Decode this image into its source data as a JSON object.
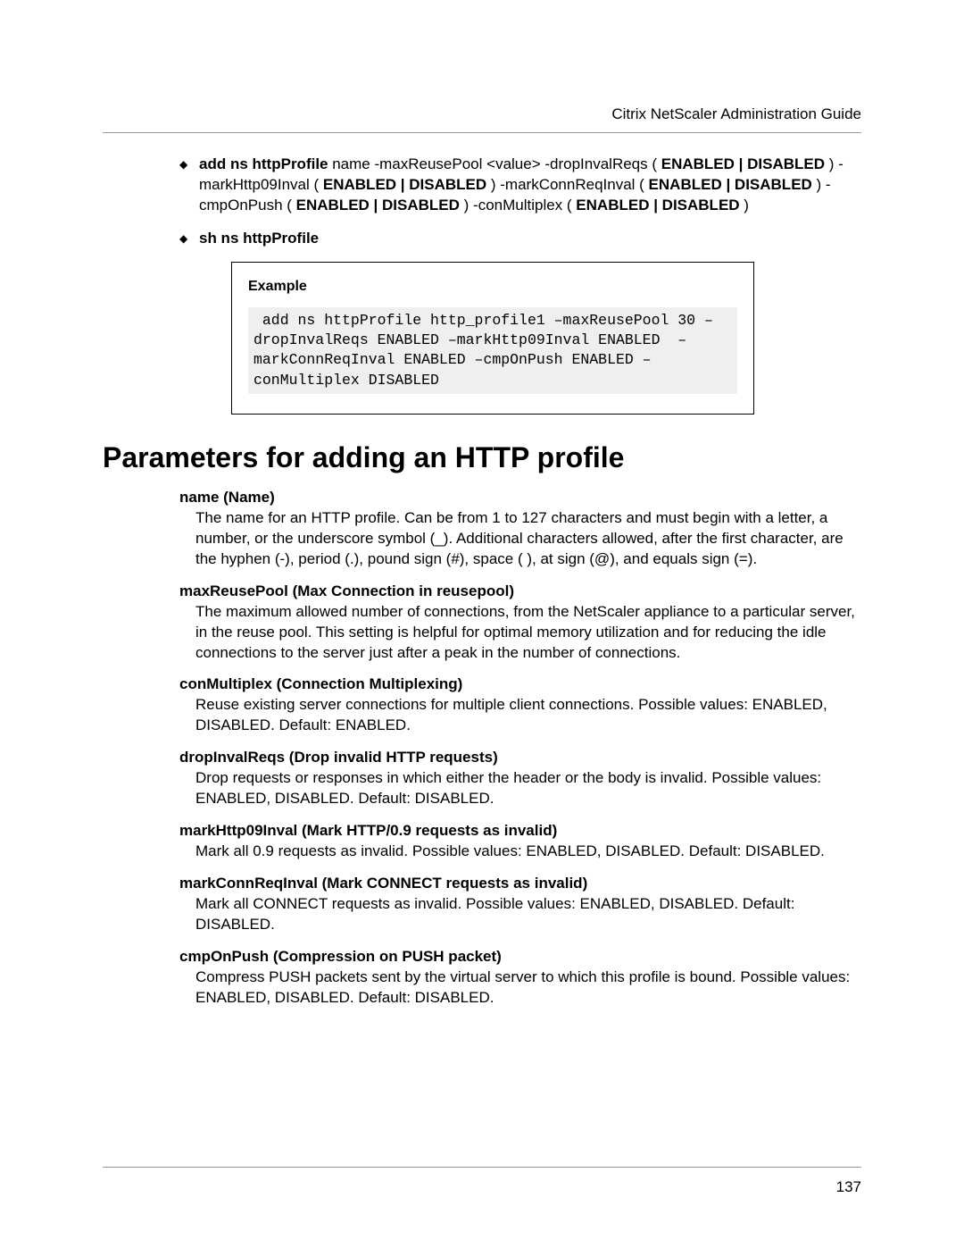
{
  "headerTitle": "Citrix NetScaler Administration Guide",
  "pageNumber": "137",
  "bullet1_parts": [
    {
      "t": "add ns httpProfile",
      "b": true
    },
    {
      "t": " name -maxReusePool <value> -dropInvalReqs ( ",
      "b": false
    },
    {
      "t": "ENABLED | DISABLED",
      "b": true
    },
    {
      "t": " ) -markHttp09Inval ( ",
      "b": false
    },
    {
      "t": "ENABLED | DISABLED",
      "b": true
    },
    {
      "t": " ) -markConnReqInval ( ",
      "b": false
    },
    {
      "t": "ENABLED | DISABLED",
      "b": true
    },
    {
      "t": " ) -cmpOnPush ( ",
      "b": false
    },
    {
      "t": "ENABLED | DISABLED",
      "b": true
    },
    {
      "t": " ) -conMultiplex ( ",
      "b": false
    },
    {
      "t": "ENABLED | DISABLED",
      "b": true
    },
    {
      "t": " )",
      "b": false
    }
  ],
  "bullet2": "sh ns httpProfile",
  "exampleLabel": "Example",
  "exampleCode": " add ns httpProfile http_profile1 –maxReusePool 30 –dropInvalReqs ENABLED –markHttp09Inval ENABLED  –markConnReqInval ENABLED –cmpOnPush ENABLED –conMultiplex DISABLED",
  "sectionHeading": "Parameters for adding an HTTP profile",
  "params": [
    {
      "title": "name (Name)",
      "desc": "The name for an HTTP profile. Can be from 1 to 127 characters and must begin with a letter, a number, or the underscore symbol (_). Additional characters allowed, after the first character, are the hyphen (-), period (.), pound sign (#), space ( ), at sign (@), and equals sign (=)."
    },
    {
      "title": "maxReusePool (Max Connection in reusepool)",
      "desc": "The maximum allowed number of connections, from the NetScaler appliance to a particular server, in the reuse pool. This setting is helpful for optimal memory utilization and for reducing the idle connections to the server just after a peak in the number of connections."
    },
    {
      "title": "conMultiplex (Connection Multiplexing)",
      "desc": "Reuse existing server connections for multiple client connections. Possible values: ENABLED, DISABLED. Default: ENABLED."
    },
    {
      "title": "dropInvalReqs (Drop invalid HTTP requests)",
      "desc": "Drop requests or responses in which either the header or the body is invalid. Possible values: ENABLED, DISABLED. Default: DISABLED."
    },
    {
      "title": "markHttp09Inval (Mark HTTP/0.9 requests as invalid)",
      "desc": "Mark all 0.9 requests as invalid. Possible values: ENABLED, DISABLED. Default: DISABLED."
    },
    {
      "title": "markConnReqInval (Mark CONNECT requests as invalid)",
      "desc": "Mark all CONNECT requests as invalid. Possible values: ENABLED, DISABLED. Default: DISABLED."
    },
    {
      "title": "cmpOnPush (Compression on PUSH packet)",
      "desc": "Compress PUSH packets sent by the virtual server to which this profile is bound. Possible values: ENABLED, DISABLED. Default: DISABLED."
    }
  ]
}
